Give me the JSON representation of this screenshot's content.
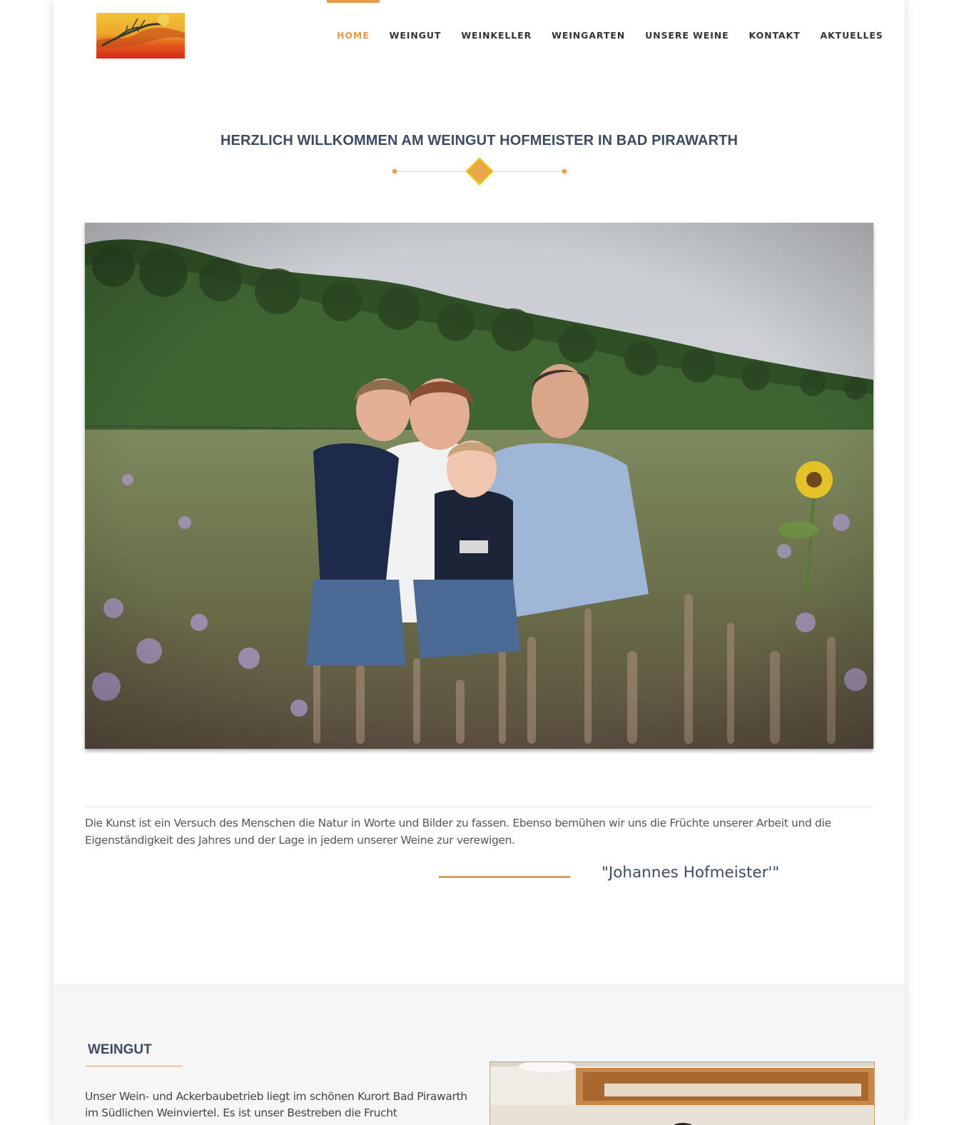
{
  "nav": {
    "items": [
      {
        "label": "HOME",
        "active": true
      },
      {
        "label": "WEINGUT"
      },
      {
        "label": "WEINKELLER"
      },
      {
        "label": "WEINGARTEN"
      },
      {
        "label": "UNSERE WEINE"
      },
      {
        "label": "KONTAKT"
      },
      {
        "label": "AKTUELLES"
      }
    ]
  },
  "intro": {
    "title": "HERZLICH WILLKOMMEN AM WEINGUT HOFMEISTER IN BAD PIRAWARTH"
  },
  "quote": {
    "text": "Die Kunst ist ein Versuch des Menschen die Natur in Worte und Bilder zu fassen. Ebenso bemühen wir uns die Früchte unserer Arbeit und die Eigenständigkeit des Jahres und der Lage in jedem unserer Weine zur verewigen.",
    "author": "\"Johannes Hofmeister'\""
  },
  "weingut": {
    "title": "WEINGUT",
    "text": "Unser Wein- und Ackerbaubetrieb liegt im schönen Kurort Bad Pirawarth im Südlichen Weinviertel. Es ist unser Bestreben die Frucht"
  },
  "colors": {
    "accent": "#e09a48",
    "heading": "#3d4b60",
    "diamond": "#e8a64c",
    "diamond_border": "#f0c419"
  }
}
